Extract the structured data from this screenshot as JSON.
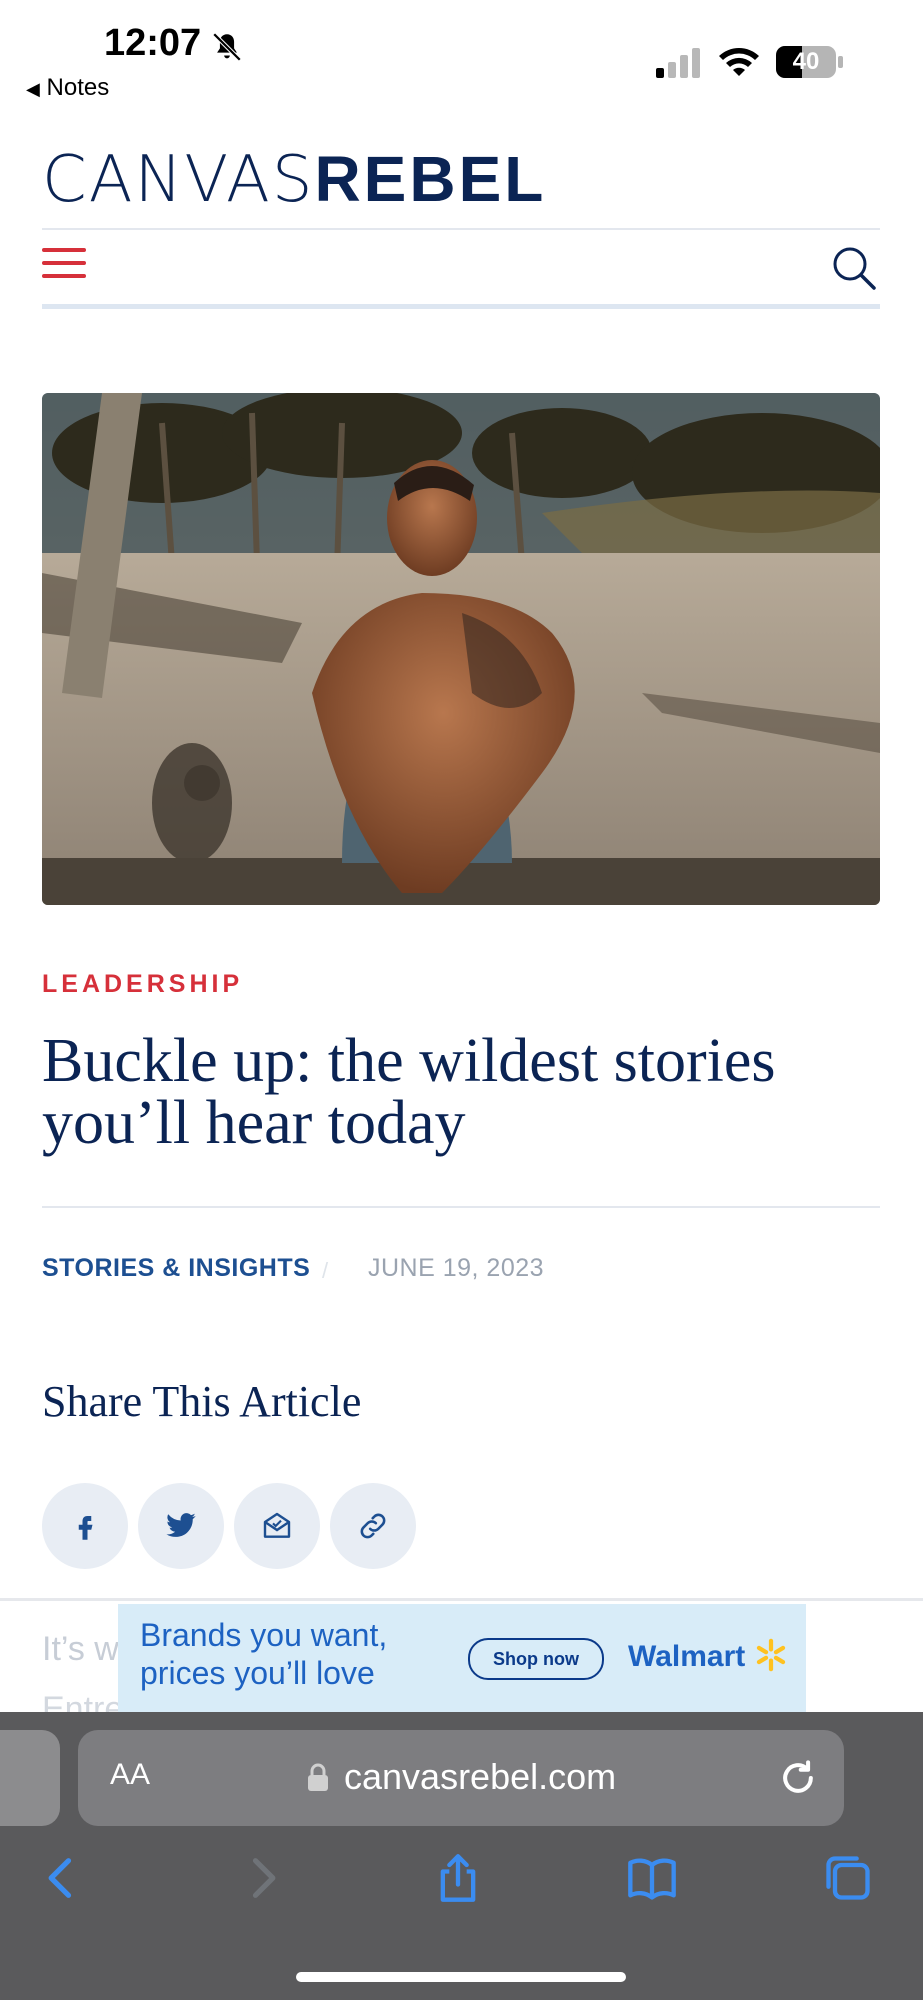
{
  "status_bar": {
    "time": "12:07",
    "back_app": "Notes",
    "battery": "40"
  },
  "site": {
    "logo_part1": "CANVAS",
    "logo_part2": "REBEL"
  },
  "article": {
    "category": "LEADERSHIP",
    "headline": "Buckle up: the wildest stories you’ll hear today",
    "byline": "STORIES & INSIGHTS",
    "separator": "/",
    "date": "JUNE 19, 2023",
    "share_title": "Share This Article",
    "body_start": "It’s w",
    "body_start2": "Entre"
  },
  "ad": {
    "line1": "Brands you want,",
    "line2": "prices you’ll love",
    "cta": "Shop now",
    "brand": "Walmart"
  },
  "safari": {
    "aa_label": "AA",
    "url": "canvasrebel.com"
  },
  "colors": {
    "navy": "#0b2454",
    "accent_red": "#d6303a",
    "link_blue": "#1d4f91",
    "toolbar_blue": "#3b8cf0"
  },
  "icons": {
    "share_buttons": [
      "facebook-icon",
      "twitter-icon",
      "email-icon",
      "link-icon"
    ]
  }
}
